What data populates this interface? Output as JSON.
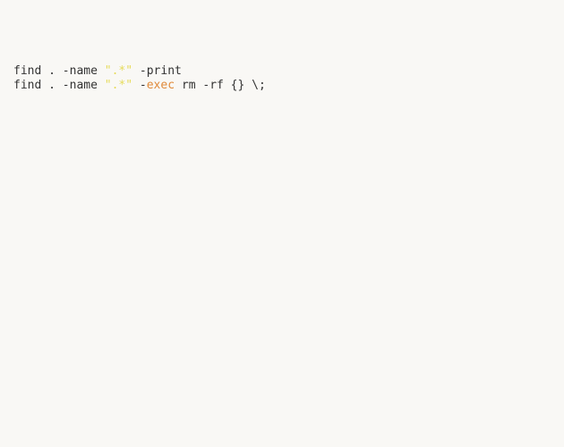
{
  "code": {
    "lines": [
      {
        "segments": [
          {
            "text": "find . ",
            "class": ""
          },
          {
            "text": "-",
            "class": ""
          },
          {
            "text": "name ",
            "class": ""
          },
          {
            "text": "\".*\"",
            "class": "tok-str"
          },
          {
            "text": " ",
            "class": ""
          },
          {
            "text": "-",
            "class": ""
          },
          {
            "text": "print",
            "class": ""
          }
        ]
      },
      {
        "segments": [
          {
            "text": "find . ",
            "class": ""
          },
          {
            "text": "-",
            "class": ""
          },
          {
            "text": "name ",
            "class": ""
          },
          {
            "text": "\".*\"",
            "class": "tok-str"
          },
          {
            "text": " ",
            "class": ""
          },
          {
            "text": "-",
            "class": ""
          },
          {
            "text": "exec",
            "class": "tok-builtin"
          },
          {
            "text": " rm ",
            "class": ""
          },
          {
            "text": "-",
            "class": ""
          },
          {
            "text": "rf ",
            "class": ""
          },
          {
            "text": "{}",
            "class": ""
          },
          {
            "text": " ",
            "class": ""
          },
          {
            "text": "\\;",
            "class": ""
          }
        ]
      }
    ]
  }
}
